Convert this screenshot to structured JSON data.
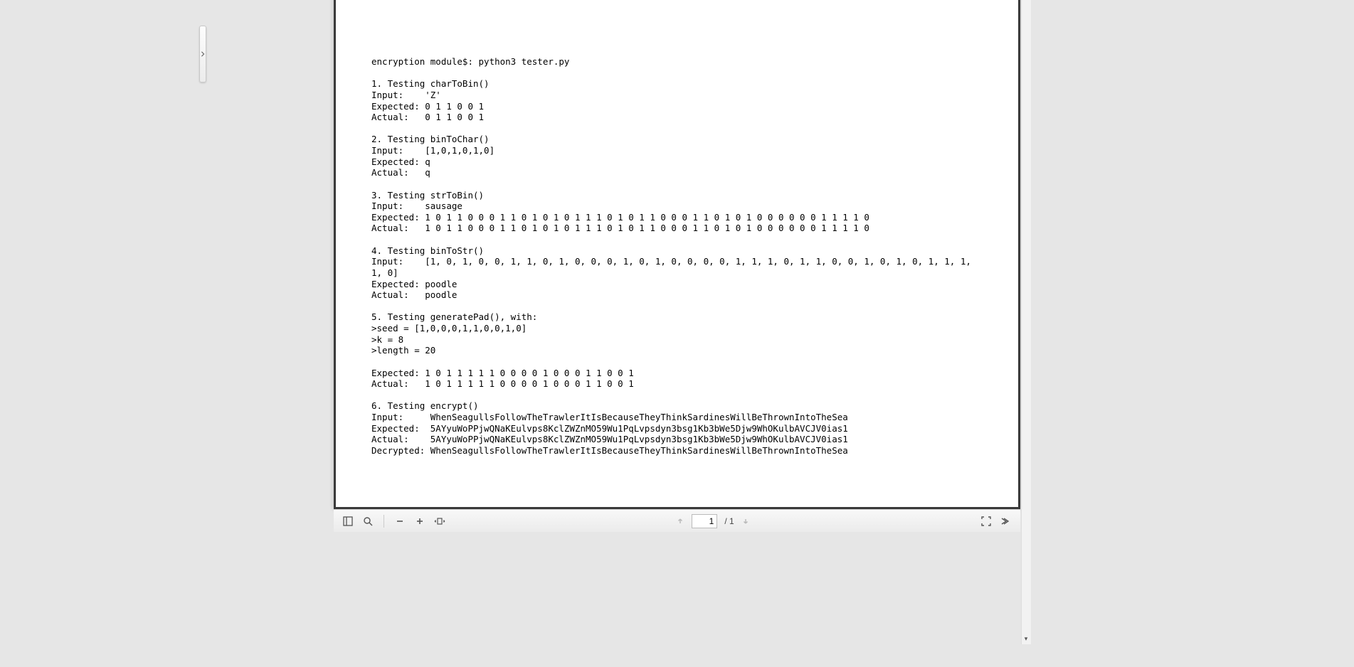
{
  "document": {
    "lines": [
      "encryption module$: python3 tester.py",
      "",
      "1. Testing charToBin()",
      "Input:    'Z'",
      "Expected: 0 1 1 0 0 1",
      "Actual:   0 1 1 0 0 1",
      "",
      "2. Testing binToChar()",
      "Input:    [1,0,1,0,1,0]",
      "Expected: q",
      "Actual:   q",
      "",
      "3. Testing strToBin()",
      "Input:    sausage",
      "Expected: 1 0 1 1 0 0 0 1 1 0 1 0 1 0 1 1 1 0 1 0 1 1 0 0 0 1 1 0 1 0 1 0 0 0 0 0 0 1 1 1 1 0",
      "Actual:   1 0 1 1 0 0 0 1 1 0 1 0 1 0 1 1 1 0 1 0 1 1 0 0 0 1 1 0 1 0 1 0 0 0 0 0 0 1 1 1 1 0",
      "",
      "4. Testing binToStr()",
      "Input:    [1, 0, 1, 0, 0, 1, 1, 0, 1, 0, 0, 0, 1, 0, 1, 0, 0, 0, 0, 1, 1, 1, 0, 1, 1, 0, 0, 1, 0, 1, 0, 1, 1, 1, 1, 0]",
      "Expected: poodle",
      "Actual:   poodle",
      "",
      "5. Testing generatePad(), with:",
      ">seed = [1,0,0,0,1,1,0,0,1,0]",
      ">k = 8",
      ">length = 20",
      "",
      "Expected: 1 0 1 1 1 1 1 0 0 0 0 1 0 0 0 1 1 0 0 1",
      "Actual:   1 0 1 1 1 1 1 0 0 0 0 1 0 0 0 1 1 0 0 1",
      "",
      "6. Testing encrypt()",
      "Input:     WhenSeagullsFollowTheTrawlerItIsBecauseTheyThinkSardinesWillBeThrownIntoTheSea",
      "Expected:  5AYyuWoPPjwQNaKEulvps8KclZWZnMO59Wu1PqLvpsdyn3bsg1Kb3bWe5Djw9WhOKulbAVCJV0ias1",
      "Actual:    5AYyuWoPPjwQNaKEulvps8KclZWZnMO59Wu1PqLvpsdyn3bsg1Kb3bWe5Djw9WhOKulbAVCJV0ias1",
      "Decrypted: WhenSeagullsFollowTheTrawlerItIsBecauseTheyThinkSardinesWillBeThrownIntoTheSea"
    ]
  },
  "toolbar": {
    "current_page": "1",
    "total_pages": "1",
    "page_sep": " / "
  }
}
